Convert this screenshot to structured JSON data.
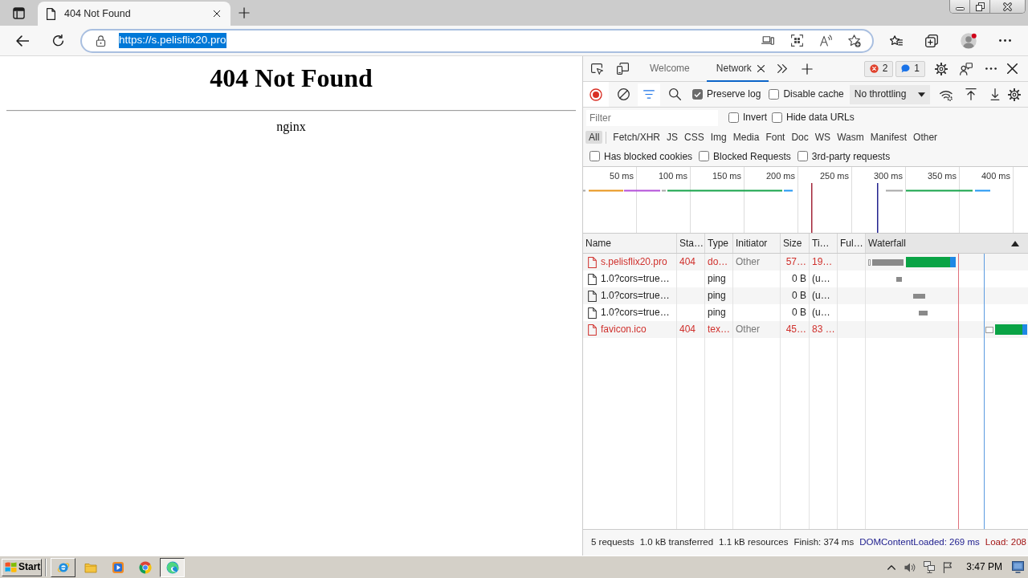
{
  "browser": {
    "tabs": [
      {
        "title": "404 Not Found",
        "selected": true
      }
    ],
    "address": {
      "url": "https://s.pelisflix20.pro",
      "selected": true
    }
  },
  "page": {
    "heading": "404 Not Found",
    "server": "nginx"
  },
  "devtools": {
    "tabs": [
      {
        "label": "Welcome",
        "selected": false,
        "closable": false
      },
      {
        "label": "Network",
        "selected": true,
        "closable": true
      }
    ],
    "counters": [
      {
        "kind": "error",
        "count": "2"
      },
      {
        "kind": "info",
        "count": "1"
      }
    ],
    "recording": true,
    "filter_open": true,
    "options": [
      {
        "label": "Preserve log",
        "checked": true
      },
      {
        "label": "Disable cache",
        "checked": false
      }
    ],
    "throttling": {
      "value": "No throttling"
    },
    "filter": {
      "placeholder": "Filter"
    },
    "filter_options": [
      {
        "label": "Invert",
        "checked": false
      },
      {
        "label": "Hide data URLs",
        "checked": false
      }
    ],
    "types": [
      {
        "label": "All",
        "selected": true
      },
      {
        "label": "Fetch/XHR",
        "selected": false
      },
      {
        "label": "JS",
        "selected": false
      },
      {
        "label": "CSS",
        "selected": false
      },
      {
        "label": "Img",
        "selected": false
      },
      {
        "label": "Media",
        "selected": false
      },
      {
        "label": "Font",
        "selected": false
      },
      {
        "label": "Doc",
        "selected": false
      },
      {
        "label": "WS",
        "selected": false
      },
      {
        "label": "Wasm",
        "selected": false
      },
      {
        "label": "Manifest",
        "selected": false
      },
      {
        "label": "Other",
        "selected": false
      }
    ],
    "blocked_options": [
      {
        "label": "Has blocked cookies",
        "checked": false
      },
      {
        "label": "Blocked Requests",
        "checked": false
      },
      {
        "label": "3rd-party requests",
        "checked": false
      }
    ],
    "overview": {
      "ticks": [
        "50 ms",
        "100 ms",
        "150 ms",
        "200 ms",
        "250 ms",
        "300 ms",
        "350 ms",
        "400 ms"
      ]
    },
    "table": {
      "columns": [
        {
          "label": "Name",
          "sorted": false
        },
        {
          "label": "Sta…",
          "sorted": false
        },
        {
          "label": "Type",
          "sorted": false
        },
        {
          "label": "Initiator",
          "sorted": false
        },
        {
          "label": "Size",
          "sorted": false
        },
        {
          "label": "Ti…",
          "sorted": false
        },
        {
          "label": "Ful…",
          "sorted": false
        },
        {
          "label": "Waterfall",
          "sorted": true
        }
      ],
      "rows": [
        {
          "name": "s.pelisflix20.pro",
          "status": "404",
          "type": "do…",
          "initiator": "Other",
          "size": "57…",
          "time": "19…",
          "failed": true
        },
        {
          "name": "1.0?cors=true…",
          "type": "ping",
          "size": "0 B",
          "time": "(u…",
          "failed": false
        },
        {
          "name": "1.0?cors=true…",
          "type": "ping",
          "size": "0 B",
          "time": "(u…",
          "failed": false
        },
        {
          "name": "1.0?cors=true…",
          "type": "ping",
          "size": "0 B",
          "time": "(u…",
          "failed": false
        },
        {
          "name": "favicon.ico",
          "status": "404",
          "type": "tex…",
          "initiator": "Other",
          "size": "45…",
          "time": "83 …",
          "failed": true
        }
      ]
    },
    "summary": [
      {
        "kind": "plain",
        "text": "5 requests"
      },
      {
        "kind": "plain",
        "text": "1.0 kB transferred"
      },
      {
        "kind": "plain",
        "text": "1.1 kB resources"
      },
      {
        "kind": "plain",
        "text": "Finish: 374 ms"
      },
      {
        "kind": "dom",
        "text": "DOMContentLoaded: 269 ms"
      },
      {
        "kind": "load",
        "text": "Load: 208"
      }
    ]
  },
  "taskbar": {
    "start": "Start",
    "apps": [
      {
        "kind": "ie",
        "open": true,
        "selected": false
      },
      {
        "kind": "explorer",
        "open": false,
        "selected": false
      },
      {
        "kind": "media",
        "open": false,
        "selected": false
      },
      {
        "kind": "chrome",
        "open": false,
        "selected": false
      },
      {
        "kind": "edge",
        "open": true,
        "selected": true
      }
    ],
    "clock": "3:47 PM"
  }
}
